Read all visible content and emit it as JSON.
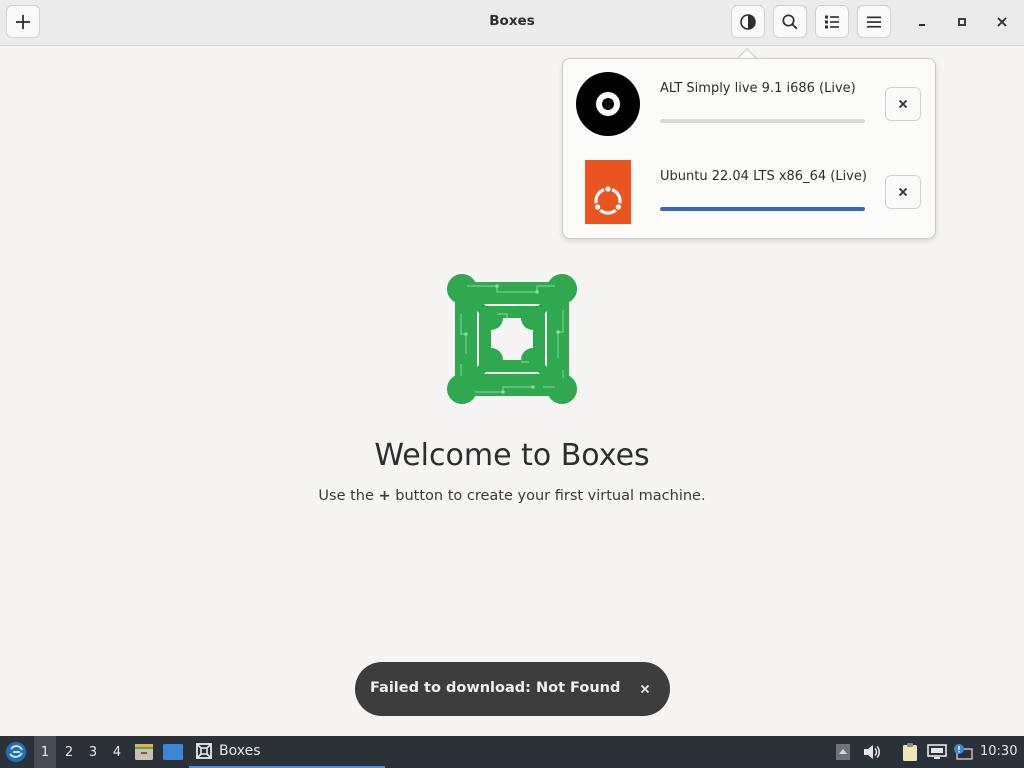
{
  "window": {
    "title": "Boxes",
    "buttons": {
      "new": "plus-icon",
      "theme": "half-circle-icon",
      "search": "search-icon",
      "view": "list-view-icon",
      "menu": "hamburger-icon",
      "minimize": "minimize-icon",
      "maximize": "maximize-icon",
      "close": "close-icon"
    }
  },
  "downloads": [
    {
      "name": "ALT Simply live 9.1 i686 (Live)",
      "progress": 0.0,
      "icon": "disc-icon"
    },
    {
      "name": "Ubuntu 22.04 LTS x86_64 (Live)",
      "progress": 1.0,
      "icon": "ubuntu-icon",
      "accent": "#e95420"
    }
  ],
  "welcome": {
    "title": "Welcome to Boxes",
    "subtitle_before": "Use the",
    "subtitle_plus": "+",
    "subtitle_after": "button to create your first virtual machine."
  },
  "toast": {
    "message": "Failed to download: Not Found"
  },
  "taskbar": {
    "workspaces": [
      "1",
      "2",
      "3",
      "4"
    ],
    "active_workspace": "1",
    "task_label": "Boxes",
    "clock": "10:30"
  },
  "colors": {
    "progress_accent": "#3569b8",
    "logo_green": "#2fa84f",
    "taskbar_bg": "#2b3138",
    "toast_bg": "#3d3d3d"
  }
}
